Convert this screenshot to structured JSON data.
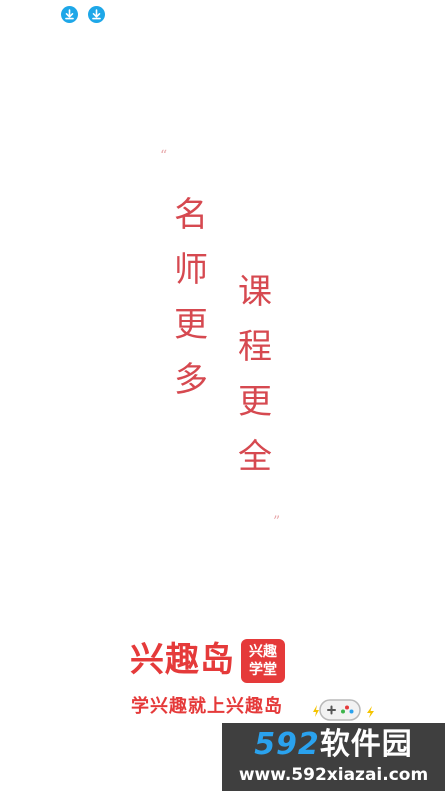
{
  "status_bar": {
    "icons": [
      "download-icon",
      "download-icon"
    ]
  },
  "slogan": {
    "open_quote": "“",
    "close_quote": "”",
    "left_column": [
      "名",
      "师",
      "更",
      "多"
    ],
    "right_column": [
      "课",
      "程",
      "更",
      "全"
    ]
  },
  "brand": {
    "name": "兴趣岛",
    "badge_line1": "兴趣",
    "badge_line2": "学堂",
    "tagline": "学兴趣就上兴趣岛"
  },
  "watermark": {
    "number": "592",
    "text": "软件园",
    "url": "www.592xiazai.com"
  },
  "colors": {
    "accent_red": "#e53a3a",
    "slogan_red": "#d64950",
    "status_icon_blue": "#1ea7e8",
    "watermark_bg": "#3f3f3f"
  }
}
